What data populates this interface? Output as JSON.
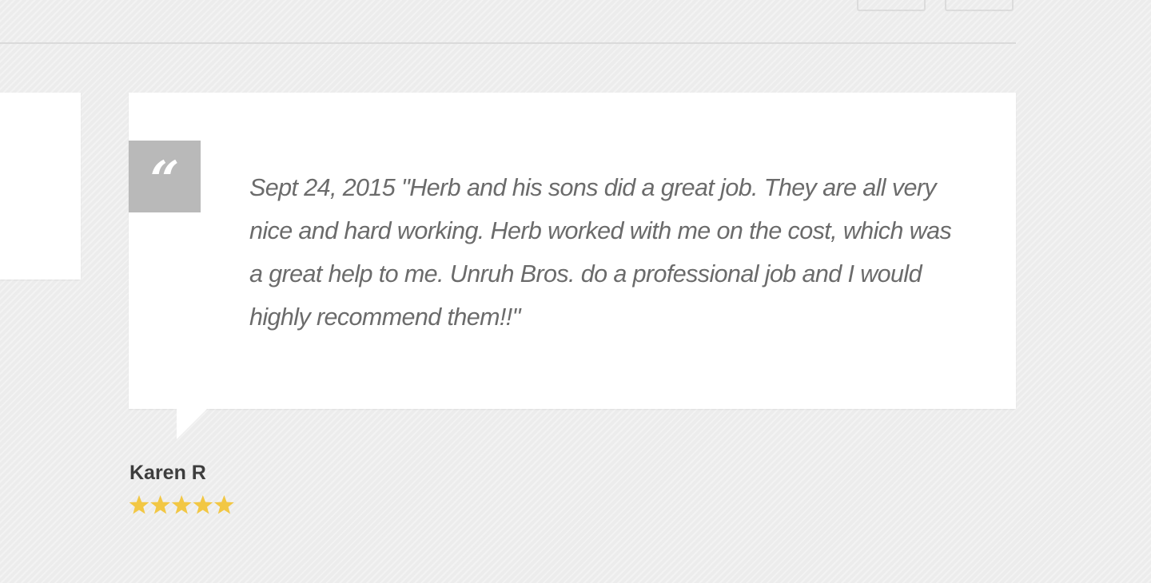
{
  "testimonial": {
    "quote_icon": "quote-mark-icon",
    "quote_glyph": "“",
    "text": "Sept 24, 2015 \"Herb and his sons did a great job. They are all very nice and hard working. Herb worked with me on the cost, which was a great help to me. Unruh Bros. do a professional job and I would highly recommend them!!\"",
    "author": "Karen R",
    "rating": 5,
    "rating_max": 5,
    "star_icon": "star-icon"
  },
  "navigation": {
    "prev_icon": "previous-arrow-icon",
    "next_icon": "next-arrow-icon"
  },
  "colors": {
    "background": "#ececec",
    "card": "#ffffff",
    "quote_box": "#b9b9b9",
    "text": "#6b6b6b",
    "author": "#3d3d3d",
    "star": "#f2c744",
    "divider": "#dadada"
  }
}
